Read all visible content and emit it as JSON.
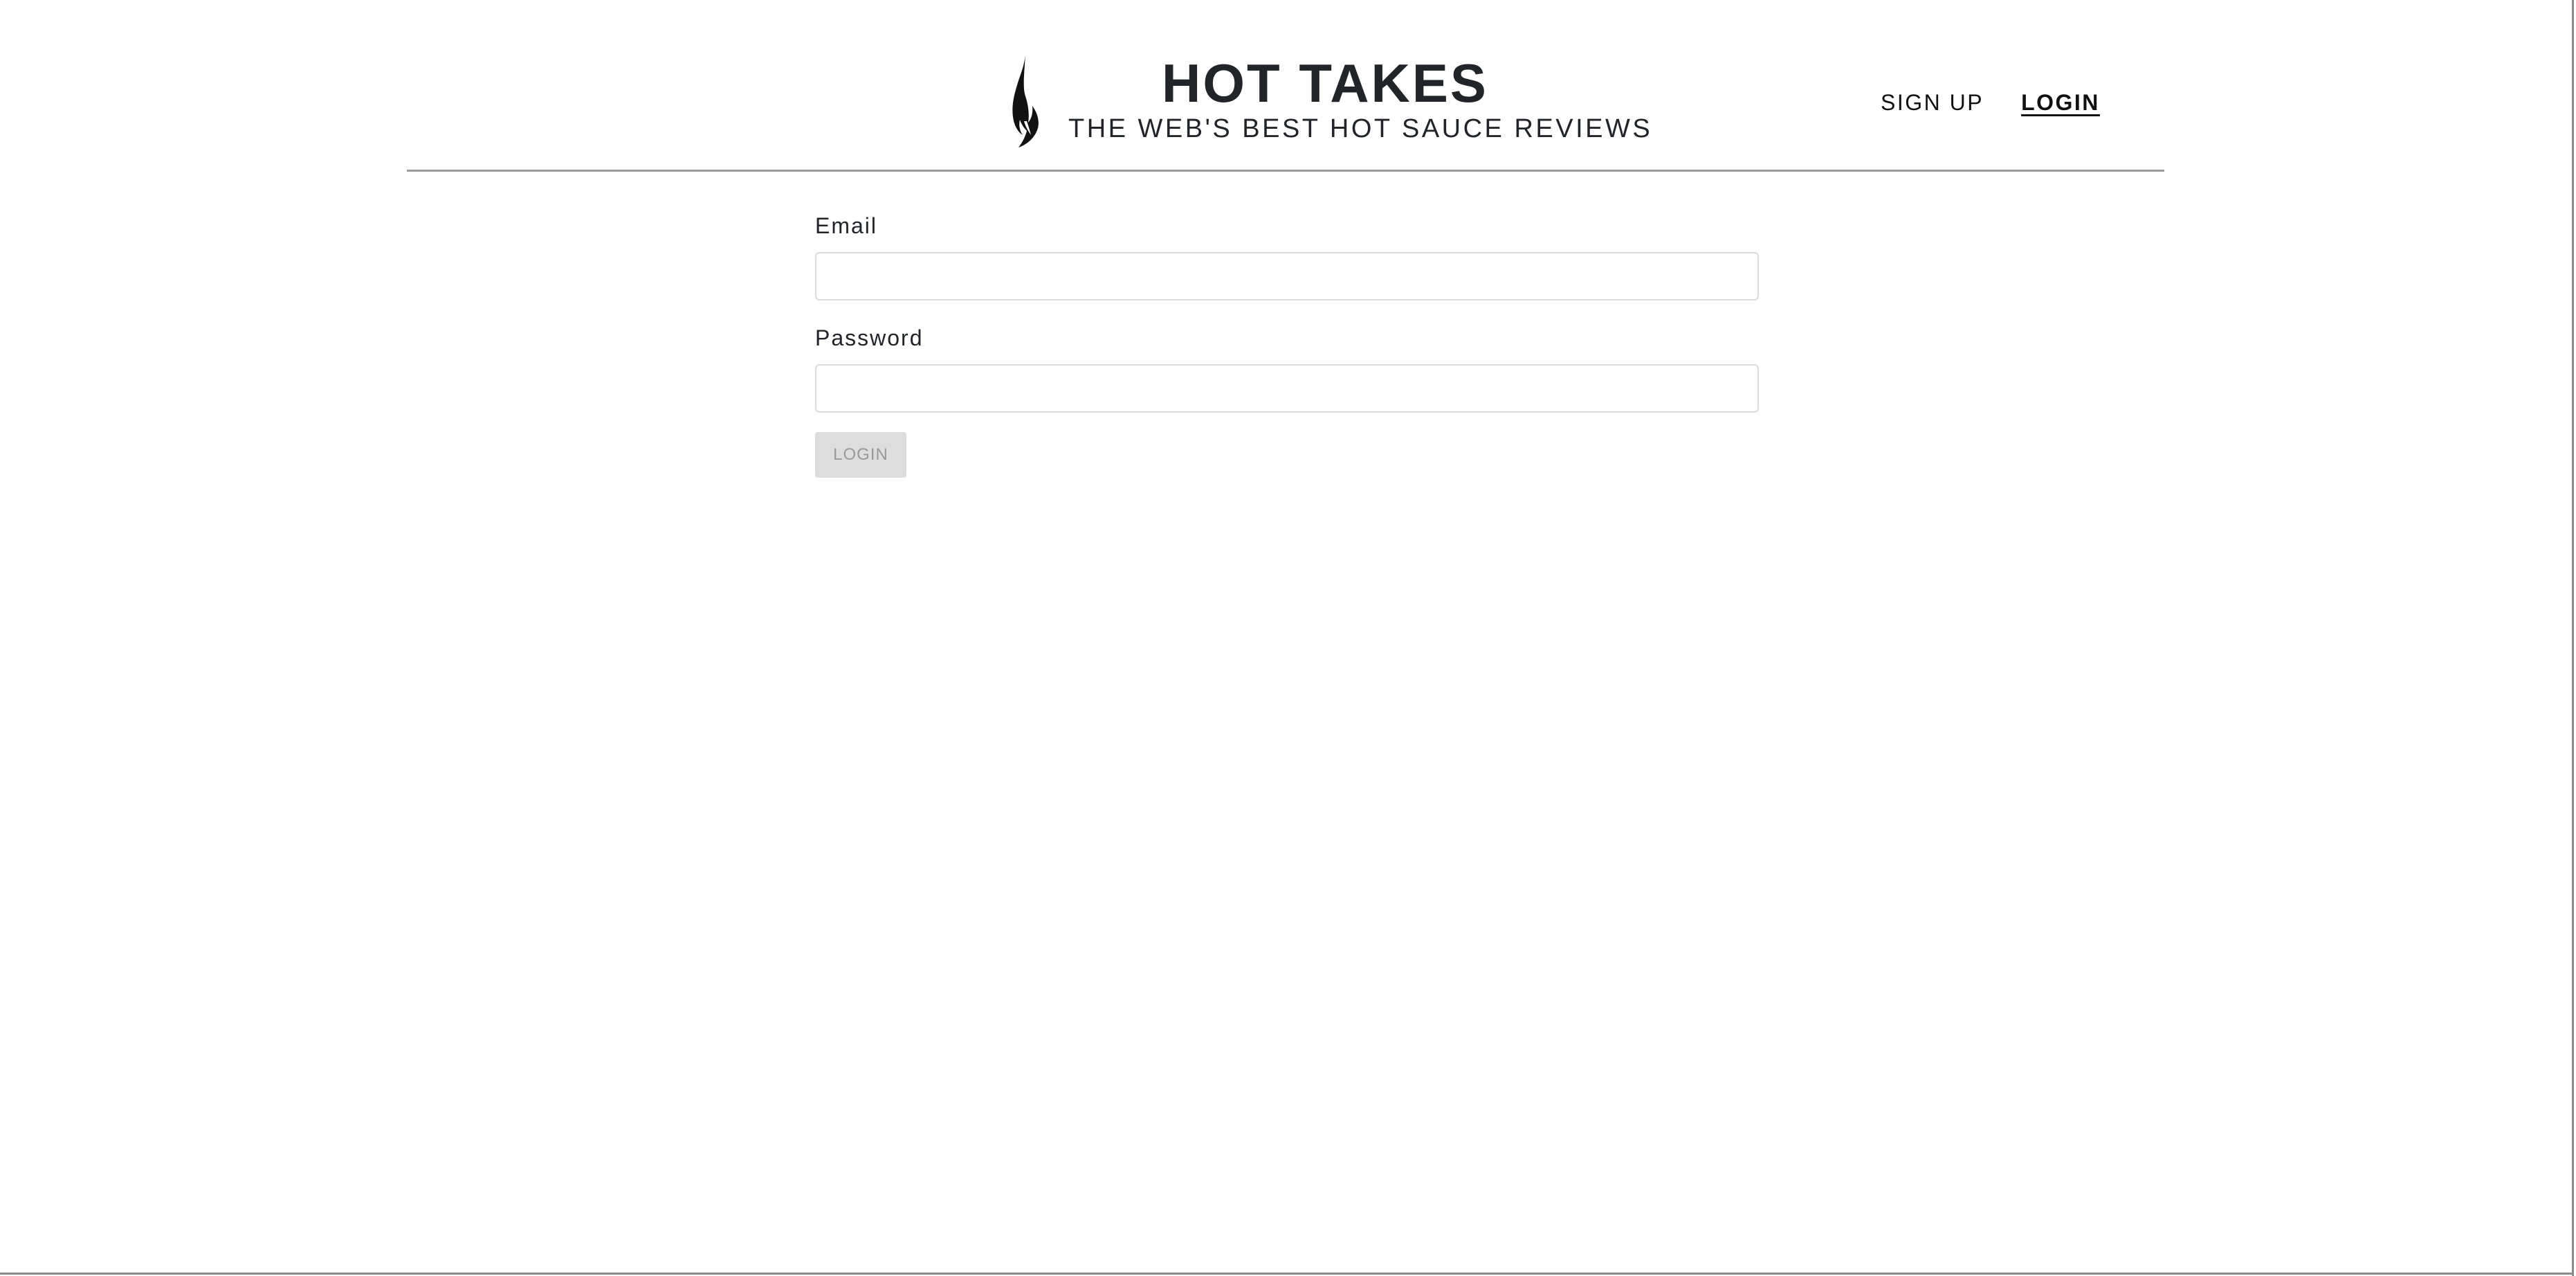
{
  "header": {
    "title": "HOT TAKES",
    "subtitle": "THE WEB'S BEST HOT SAUCE REVIEWS",
    "logo_icon": "flame-icon"
  },
  "nav": {
    "signup_label": "SIGN UP",
    "login_label": "LOGIN",
    "active": "login"
  },
  "form": {
    "email_label": "Email",
    "email_value": "",
    "email_placeholder": "",
    "password_label": "Password",
    "password_value": "",
    "password_placeholder": "",
    "submit_label": "LOGIN",
    "submit_disabled": true
  },
  "colors": {
    "text": "#212529",
    "rule": "#9a9a9a",
    "input_border": "#dcdcdc",
    "button_bg": "#dddddd",
    "button_text": "#999999"
  }
}
